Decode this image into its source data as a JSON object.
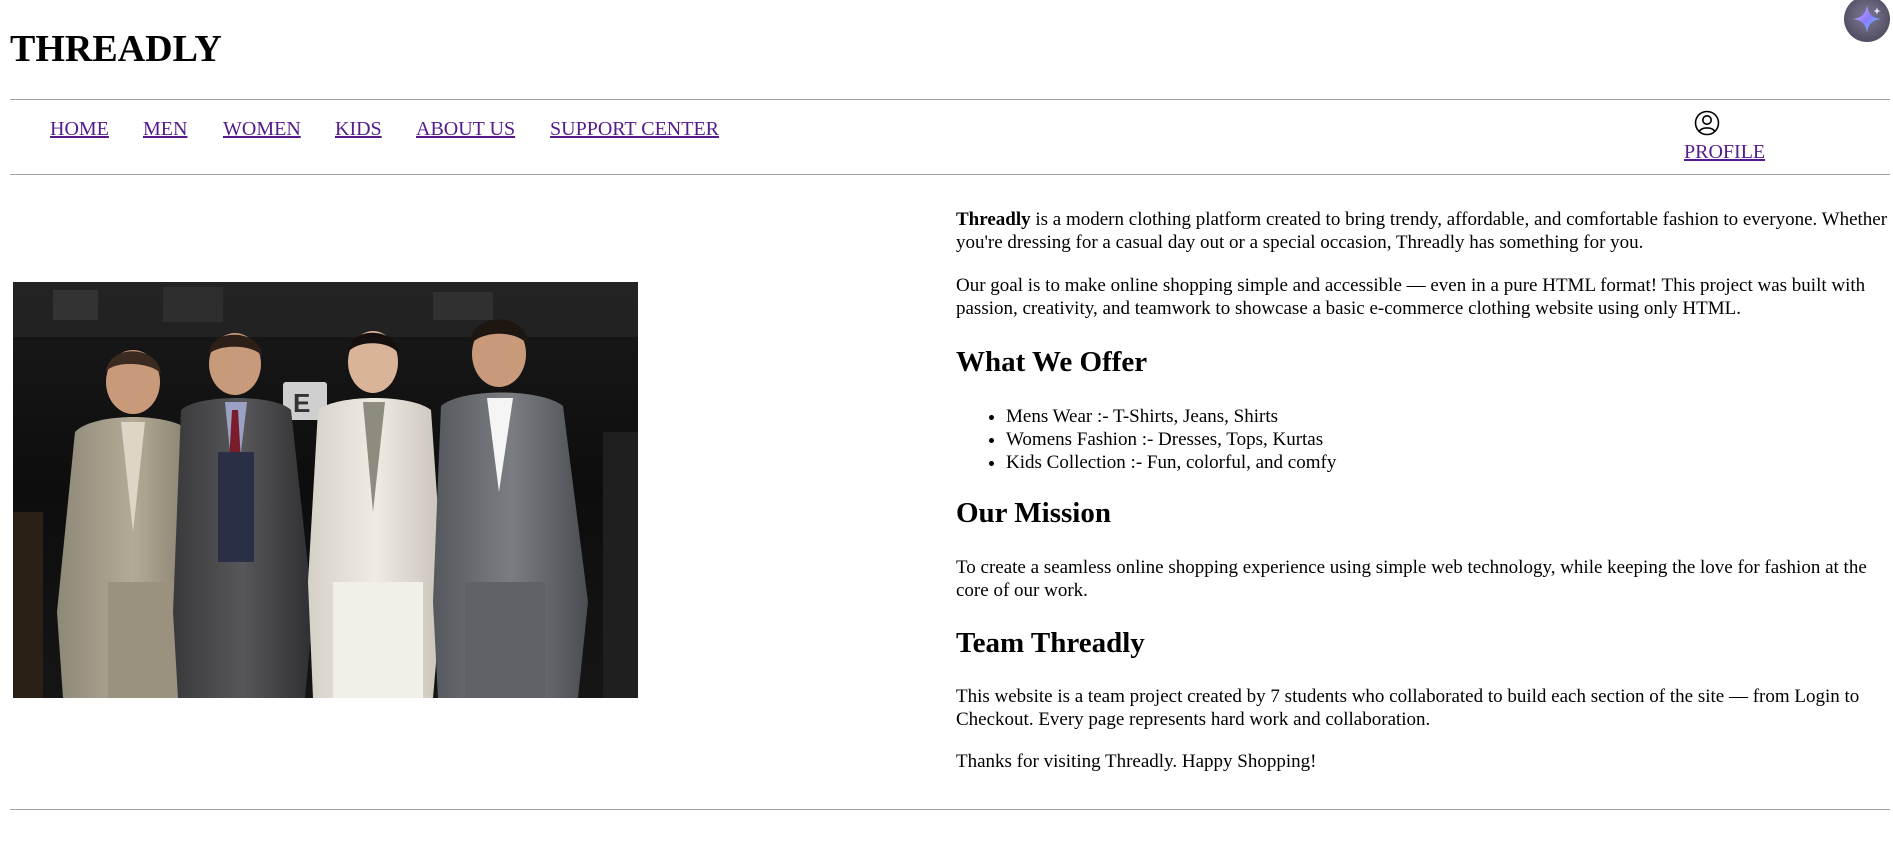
{
  "site": {
    "title": "THREADLY"
  },
  "nav": {
    "items": [
      {
        "label": "HOME"
      },
      {
        "label": "MEN"
      },
      {
        "label": "WOMEN"
      },
      {
        "label": "KIDS"
      },
      {
        "label": "ABOUT US"
      },
      {
        "label": "SUPPORT CENTER"
      }
    ],
    "profile_label": "PROFILE",
    "profile_icon": "user-circle-icon",
    "link_color": "#551a8b"
  },
  "fab": {
    "icon": "sparkle-icon"
  },
  "about": {
    "intro_bold": "Threadly",
    "intro_rest": " is a modern clothing platform created to bring trendy, affordable, and comfortable fashion to everyone. Whether you're dressing for a casual day out or a special occasion, Threadly has something for you.",
    "goal": "Our goal is to make online shopping simple and accessible — even in a pure HTML format! This project was built with passion, creativity, and teamwork to showcase a basic e-commerce clothing website using only HTML.",
    "offer_heading": "What We Offer",
    "offers": [
      "Mens Wear :- T-Shirts, Jeans, Shirts",
      "Womens Fashion :- Dresses, Tops, Kurtas",
      "Kids Collection :- Fun, colorful, and comfy"
    ],
    "mission_heading": "Our Mission",
    "mission": "To create a seamless online shopping experience using simple web technology, while keeping the love for fashion at the core of our work.",
    "team_heading": "Team Threadly",
    "team": "This website is a team project created by 7 students who collaborated to build each section of the site — from Login to Checkout. Every page represents hard work and collaboration.",
    "thanks": "Thanks for visiting Threadly. Happy Shopping!"
  }
}
